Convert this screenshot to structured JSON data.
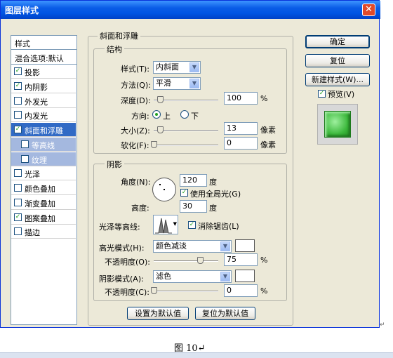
{
  "window": {
    "title": "图层样式",
    "close_glyph": "✕"
  },
  "sidebar": {
    "header": "样式",
    "blend": "混合选项:默认",
    "items": [
      {
        "label": "投影",
        "checked": true
      },
      {
        "label": "内阴影",
        "checked": true
      },
      {
        "label": "外发光",
        "checked": false
      },
      {
        "label": "内发光",
        "checked": false
      },
      {
        "label": "斜面和浮雕",
        "checked": true
      },
      {
        "label": "等高线",
        "checked": false
      },
      {
        "label": "纹理",
        "checked": false
      },
      {
        "label": "光泽",
        "checked": false
      },
      {
        "label": "颜色叠加",
        "checked": false
      },
      {
        "label": "渐变叠加",
        "checked": false
      },
      {
        "label": "图案叠加",
        "checked": true
      },
      {
        "label": "描边",
        "checked": false
      }
    ]
  },
  "bevel": {
    "title": "斜面和浮雕",
    "structure": {
      "title": "结构",
      "style_label": "样式(T):",
      "style_value": "内斜面",
      "technique_label": "方法(Q):",
      "technique_value": "平滑",
      "depth_label": "深度(D):",
      "depth_value": "100",
      "depth_unit": "%",
      "depth_level": 0.1,
      "direction_label": "方向:",
      "dir_up": "上",
      "dir_down": "下",
      "dir_selected": "上",
      "size_label": "大小(Z):",
      "size_value": "13",
      "size_unit": "像素",
      "size_level": 0.1,
      "soften_label": "软化(F):",
      "soften_value": "0",
      "soften_unit": "像素",
      "soften_level": 0.0
    },
    "shading": {
      "title": "阴影",
      "angle_label": "角度(N):",
      "angle_value": "120",
      "angle_unit": "度",
      "global_light": "使用全局光(G)",
      "global_light_checked": true,
      "altitude_label": "高度:",
      "altitude_value": "30",
      "altitude_unit": "度",
      "gloss_label": "光泽等高线:",
      "antialias": "消除锯齿(L)",
      "antialias_checked": true,
      "highlight_label": "高光模式(H):",
      "highlight_mode": "颜色减淡",
      "highlight_color": "#ffffff",
      "hl_opacity_label": "不透明度(O):",
      "hl_opacity_value": "75",
      "hl_opacity_unit": "%",
      "hl_opacity_level": 0.75,
      "shadow_label": "阴影模式(A):",
      "shadow_mode": "滤色",
      "shadow_color": "#ffffff",
      "sh_opacity_label": "不透明度(C):",
      "sh_opacity_value": "0",
      "sh_opacity_unit": "%",
      "sh_opacity_level": 0.0
    },
    "btn_default": "设置为默认值",
    "btn_reset_default": "复位为默认值"
  },
  "right": {
    "ok": "确定",
    "reset": "复位",
    "new_style": "新建样式(W)...",
    "preview": "预览(V)",
    "preview_checked": true,
    "preview_color": "#3cb83c"
  },
  "caption": "图 10↵",
  "para_mark": "↵"
}
